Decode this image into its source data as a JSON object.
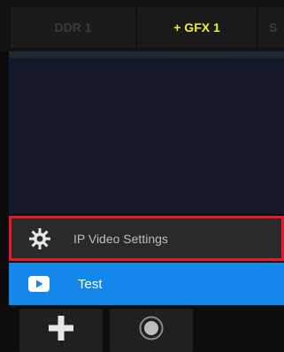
{
  "tabs": {
    "ddr": "DDR 1",
    "gfx": "+ GFX 1",
    "third": "S"
  },
  "menu": {
    "settings_label": "IP Video Settings",
    "settings_icon": "gear-icon",
    "test_label": "Test",
    "test_icon": "youtube-icon"
  },
  "toolbar": {
    "add_icon": "plus-icon",
    "record_icon": "record-icon"
  },
  "colors": {
    "gfx_tab_text": "#f0ee2e",
    "selected_row": "#1487ea",
    "highlight_border": "#e8182a"
  }
}
